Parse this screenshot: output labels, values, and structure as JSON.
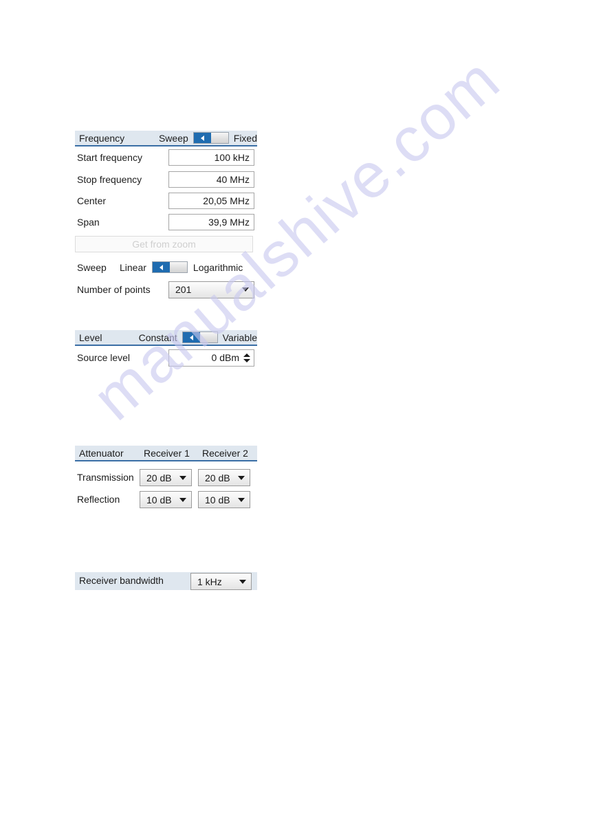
{
  "watermark": {
    "text": "manualshive.com"
  },
  "frequency_section": {
    "title": "Frequency",
    "mode_toggle": {
      "left_label": "Sweep",
      "right_label": "Fixed",
      "selected": "Sweep",
      "icon": "toggle-left-triangle-icon"
    },
    "fields": [
      {
        "label": "Start frequency",
        "value": "100 kHz"
      },
      {
        "label": "Stop frequency",
        "value": "40 MHz"
      },
      {
        "label": "Center",
        "value": "20,05 MHz"
      },
      {
        "label": "Span",
        "value": "39,9 MHz"
      }
    ],
    "get_from_zoom_button": {
      "label": "Get from zoom",
      "enabled": false
    },
    "sweep_toggle": {
      "label": "Sweep",
      "left_label": "Linear",
      "right_label": "Logarithmic",
      "selected": "Linear",
      "icon": "toggle-left-triangle-icon"
    },
    "number_of_points": {
      "label": "Number of points",
      "value": "201",
      "icon": "chevron-down-icon"
    }
  },
  "level_section": {
    "title": "Level",
    "mode_toggle": {
      "left_label": "Constant",
      "right_label": "Variable",
      "selected": "Constant",
      "icon": "toggle-left-triangle-icon"
    },
    "source_level": {
      "label": "Source level",
      "value": "0 dBm",
      "icon": "spinner-up-down-icon"
    }
  },
  "attenuator_section": {
    "title": "Attenuator",
    "columns": [
      "Receiver 1",
      "Receiver 2"
    ],
    "rows": [
      {
        "label": "Transmission",
        "receiver1": "20 dB",
        "receiver2": "20 dB"
      },
      {
        "label": "Reflection",
        "receiver1": "10 dB",
        "receiver2": "10 dB"
      }
    ],
    "icon": "chevron-down-icon"
  },
  "receiver_bandwidth": {
    "label": "Receiver bandwidth",
    "value": "1 kHz",
    "icon": "chevron-down-icon"
  },
  "colors": {
    "header_band": "#dfe7ef",
    "header_rule": "#3a6ea5",
    "toggle_active": "#1f6cb0",
    "watermark": "#c9c9ef"
  }
}
